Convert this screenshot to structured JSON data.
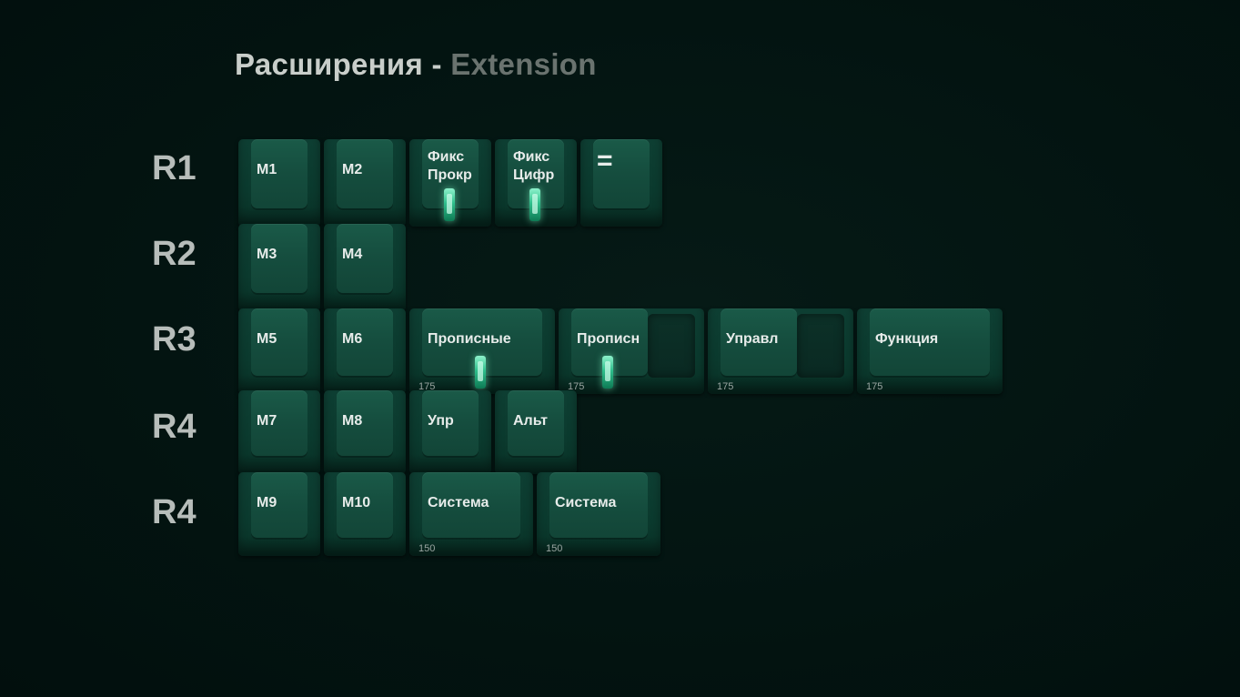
{
  "title": {
    "ru": "Расширения",
    "sep": "-",
    "en": "Extension"
  },
  "rows": [
    "R1",
    "R2",
    "R3",
    "R4",
    "R4"
  ],
  "keys": {
    "m1": "M1",
    "m2": "M2",
    "fix_scroll": "Фикс\nПрокр",
    "fix_num": "Фикс\nЦифр",
    "equals": "=",
    "m3": "M3",
    "m4": "M4",
    "m5": "M5",
    "m6": "M6",
    "caps1": "Прописные",
    "caps1_size": "175",
    "caps2": "Прописн",
    "caps2_size": "175",
    "ctrl_r3": "Управл",
    "ctrl_r3_size": "175",
    "fn": "Функция",
    "fn_size": "175",
    "m7": "M7",
    "m8": "M8",
    "ctrl": "Упр",
    "alt": "Альт",
    "m9": "M9",
    "m10": "M10",
    "sys1": "Система",
    "sys1_size": "150",
    "sys2": "Система",
    "sys2_size": "150"
  }
}
